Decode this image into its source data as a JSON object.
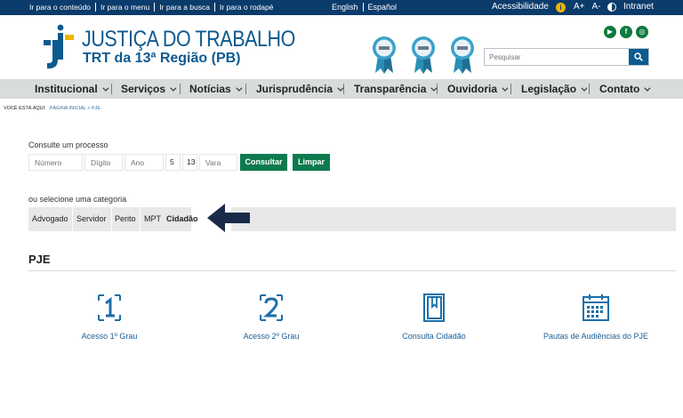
{
  "topbar": {
    "skip_links": [
      "Ir para o conteúdo",
      "Ir para o menu",
      "Ir para a busca",
      "Ir para o rodapé"
    ],
    "languages": [
      "English",
      "Español"
    ],
    "accessibility_label": "Acessibilidade",
    "font_increase": "A+",
    "font_decrease": "A-",
    "intranet_label": "Intranet"
  },
  "header": {
    "title": "JUSTIÇA DO TRABALHO",
    "subtitle": "TRT da 13ª Região (PB)",
    "search_placeholder": "Pesquisar",
    "social_icons": [
      "youtube-icon",
      "facebook-icon",
      "instagram-icon"
    ],
    "seals": [
      "award-seal-icon",
      "award-seal-icon",
      "award-seal-icon"
    ]
  },
  "menu": {
    "items": [
      "Institucional",
      "Serviços",
      "Notícias",
      "Jurisprudência",
      "Transparência",
      "Ouvidoria",
      "Legislação",
      "Contato"
    ]
  },
  "breadcrumb": {
    "prefix": "VOCÊ ESTÁ AQUI:",
    "path": "PÁGINA INICIAL > PJE"
  },
  "consulta": {
    "label": "Consulte um processo",
    "fields": {
      "numero_placeholder": "Número",
      "digito_placeholder": "Dígito",
      "ano_placeholder": "Ano",
      "justica_value": "5",
      "tribunal_value": "13",
      "vara_placeholder": "Vara"
    },
    "consultar_label": "Consultar",
    "limpar_label": "Limpar"
  },
  "categorias": {
    "label": "ou selecione uma categoria",
    "items": [
      "Advogado",
      "Servidor",
      "Perito",
      "MPT",
      "Cidadão"
    ],
    "selected": "Cidadão"
  },
  "pje": {
    "title": "PJE",
    "tiles": [
      {
        "label": "Acesso 1º Grau",
        "icon": "number-one-icon"
      },
      {
        "label": "Acesso 2º Grau",
        "icon": "number-two-icon"
      },
      {
        "label": "Consulta Cidadão",
        "icon": "book-icon"
      },
      {
        "label": "Pautas de Audiências do PJE",
        "icon": "calendar-icon"
      }
    ]
  },
  "colors": {
    "topbar_bg": "#0b3b6b",
    "brand_blue": "#0d5a8f",
    "button_green": "#0d7a4e",
    "menu_bg": "#d9dcdc",
    "link_blue": "#1c5e96",
    "arrow": "#1a2b4a"
  }
}
